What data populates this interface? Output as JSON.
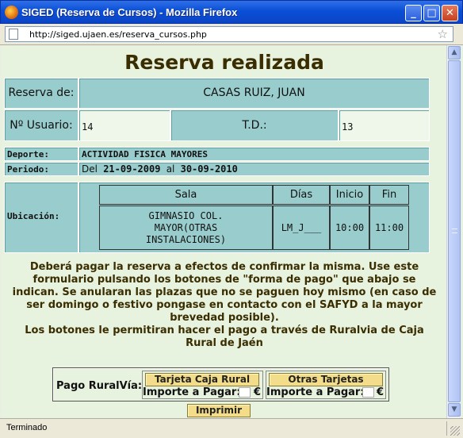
{
  "window": {
    "title": "SIGED (Reserva de Cursos) - Mozilla Firefox",
    "minimize_label": "_",
    "maximize_label": "□",
    "close_label": "✕"
  },
  "address_bar": {
    "url": "http://siged.ujaen.es/reserva_cursos.php"
  },
  "page": {
    "title": "Reserva realizada",
    "reserva_label": "Reserva de:",
    "reserva_value": "CASAS RUIZ, JUAN",
    "usuario_label": "Nº Usuario:",
    "usuario_value": "14",
    "td_label": "T.D.:",
    "td_value": "13",
    "deporte_label": "Deporte:",
    "deporte_value": "ACTIVIDAD FISICA MAYORES",
    "periodo_label": "Periodo:",
    "periodo_del": "Del",
    "periodo_start": "21-09-2009",
    "periodo_al": "al",
    "periodo_end": "30-09-2010",
    "ubicacion_label": "Ubicación:",
    "table_headers": {
      "sala": "Sala",
      "dias": "Días",
      "inicio": "Inicio",
      "fin": "Fin"
    },
    "table_row": {
      "sala": "GIMNASIO COL. MAYOR(OTRAS INSTALACIONES)",
      "dias": "LM_J___",
      "inicio": "10:00",
      "fin": "11:00"
    },
    "notice_line1": "Deberá pagar la reserva a efectos de confirmar la misma. Use este formulario pulsando los botones de \"forma de pago\" que abajo se indican. Se anularan las plazas que no se paguen hoy mismo (en caso de ser domingo o festivo pongase en contacto con el SAFYD a la mayor brevedad posible).",
    "notice_line2": "Los botones le permitiran hacer el pago a través de Ruralvia de Caja Rural de Jaén",
    "pago_label": "Pago RuralVía:",
    "btn_tarjeta_caja": "Tarjeta Caja Rural",
    "btn_otras_tarjetas": "Otras Tarjetas",
    "importe_label": "Importe a Pagar:",
    "currency": "€",
    "btn_imprimir": "Imprimir"
  },
  "status_bar": {
    "text": "Terminado"
  },
  "colors": {
    "cell_teal": "#99cccc",
    "page_bg": "#e7f2df",
    "title_brown": "#3a2d00",
    "button_gold": "#f3dc8a"
  }
}
